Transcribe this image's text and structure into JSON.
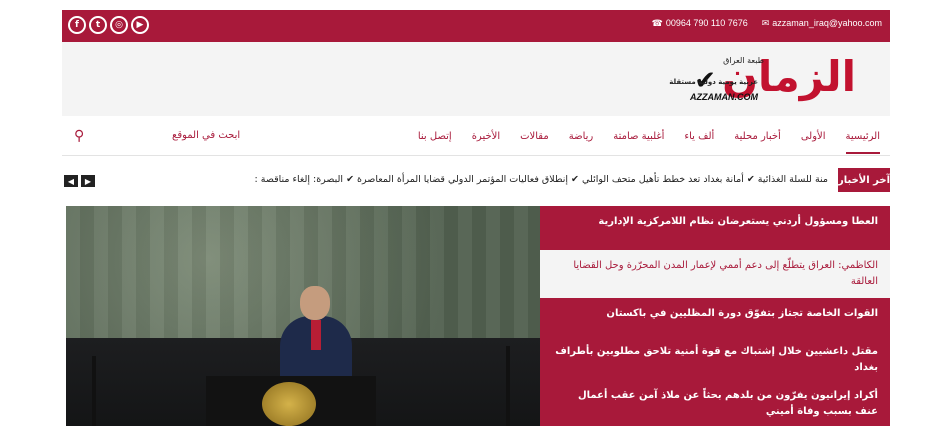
{
  "topbar": {
    "email": "azzaman_iraq@yahoo.com",
    "phone": "00964 790 110 7676",
    "social": [
      "f",
      "t",
      "ig",
      "yt"
    ],
    "colors": {
      "brand": "#a8193a"
    }
  },
  "logo": {
    "wordmark": "الزمان",
    "edition": "طبعة العراق",
    "tagline": "عربية يومية دولية مستقلة",
    "site": "AZZAMAN.COM"
  },
  "nav": {
    "items": [
      "الرئيسية",
      "الأولى",
      "أخبار محلية",
      "ألف ياء",
      "أغلبية صامتة",
      "رياضة",
      "مقالات",
      "الأخيرة",
      "إتصل بنا"
    ],
    "search_label": "ابحث في الموقع",
    "search_icon": "search-icon"
  },
  "ticker": {
    "label": "آخر الأخبار",
    "text": "منة للسلة الغذائية ✔ أمانة بغداد تعد خطط تأهيل متحف الوائلي ✔ إنطلاق فعاليات المؤتمر الدولي قضايا المرأة المعاصرة ✔ البصرة: إلغاء مناقصة :"
  },
  "news": [
    {
      "title": "العطا ومسؤول أردني يستعرضان نظام اللامركزية الإدارية",
      "style": "dark"
    },
    {
      "title": "الكاظمي: العراق يتطلّع إلى دعم أممي لإعمار المدن المحرّرة وحل القضايا العالقة",
      "style": "light"
    },
    {
      "title": "القوات الخاصة تجتاز بتفوّق دورة المظليين في باكستان",
      "style": "dark"
    },
    {
      "title": "مقتل داعشيين خلال إشتباك مع قوة أمنية تلاحق مطلوبين بأطراف بغداد",
      "style": "dark"
    },
    {
      "title": "أكراد إيرانيون يفرّون من بلدهم بحثاً عن ملاذ آمن عقب أعمال عنف بسبب وفاة أميني",
      "style": "dark"
    }
  ]
}
